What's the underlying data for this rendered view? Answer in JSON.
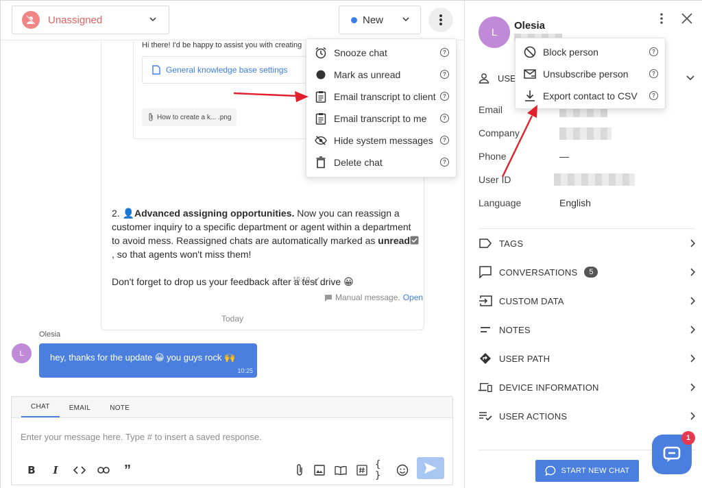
{
  "topbar": {
    "assignee_label": "Unassigned",
    "status_label": "New",
    "colors": {
      "assignee_text": "#e2605f",
      "status_dot": "#3b7de8"
    }
  },
  "chat_menu": {
    "items": [
      {
        "icon": "alarm-clock-icon",
        "label": "Snooze chat"
      },
      {
        "icon": "filled-circle-icon",
        "label": "Mark as unread"
      },
      {
        "icon": "clipboard-icon",
        "label": "Email transcript to client"
      },
      {
        "icon": "clipboard-icon",
        "label": "Email transcript to me"
      },
      {
        "icon": "eye-slash-icon",
        "label": "Hide system messages"
      },
      {
        "icon": "trash-icon",
        "label": "Delete chat"
      }
    ],
    "help_glyph": "?"
  },
  "bot_message": {
    "inner_greeting": "Hi there! I'd be happy to assist you with creating",
    "kb_link_label": "General knowledge base settings",
    "attachment_name": "How to create a k... .png",
    "point_number": "2.",
    "point_title": "Advanced assigning opportunities.",
    "point_body_1": " Now you can reassign a customer inquiry to a specific department or agent within a department to avoid mess. Reassigned chats are automatically marked as ",
    "point_bold_2": "unread",
    "point_body_2": ", so that agents won't miss them!",
    "feedback_line": "Don't forget to drop us your feedback after a test drive 😀",
    "time": "15:10",
    "manual_note": "Manual message.",
    "manual_open": "Open"
  },
  "day_separator": "Today",
  "user_message": {
    "sender": "Olesia",
    "avatar_letter": "L",
    "text": "hey, thanks for the update 😀  you guys rock 🙌",
    "time": "10:25"
  },
  "composer": {
    "tabs": [
      "CHAT",
      "EMAIL",
      "NOTE"
    ],
    "active_tab": "CHAT",
    "placeholder": "Enter your message here. Type # to insert a saved response.",
    "tool_icons": [
      "bold-icon",
      "italic-icon",
      "code-icon",
      "link-icon",
      "quote-icon",
      "paperclip-icon",
      "image-icon",
      "book-icon",
      "hashtag-icon",
      "braces-icon",
      "emoji-icon",
      "send-icon"
    ]
  },
  "contact": {
    "avatar_letter": "L",
    "name": "Olesia",
    "user_section_label": "USE",
    "fields": [
      {
        "label": "Email",
        "value": ""
      },
      {
        "label": "Company",
        "value": ""
      },
      {
        "label": "Phone",
        "value": "—"
      },
      {
        "label": "User ID",
        "value": ""
      },
      {
        "label": "Language",
        "value": "English"
      }
    ]
  },
  "contact_menu": {
    "items": [
      {
        "icon": "block-icon",
        "label": "Block person"
      },
      {
        "icon": "envelope-icon",
        "label": "Unsubscribe person"
      },
      {
        "icon": "download-icon",
        "label": "Export contact to CSV"
      }
    ],
    "help_glyph": "?"
  },
  "sections": [
    {
      "icon": "tag-icon",
      "label": "TAGS"
    },
    {
      "icon": "speech-bubble-icon",
      "label": "CONVERSATIONS",
      "badge": "5"
    },
    {
      "icon": "import-icon",
      "label": "CUSTOM DATA"
    },
    {
      "icon": "notes-icon",
      "label": "NOTES"
    },
    {
      "icon": "direction-sign-icon",
      "label": "USER PATH"
    },
    {
      "icon": "devices-icon",
      "label": "DEVICE INFORMATION"
    },
    {
      "icon": "checklist-icon",
      "label": "USER ACTIONS"
    }
  ],
  "start_chat_label": "START NEW CHAT",
  "fab_badge": "1",
  "colors": {
    "accent": "#4a7fdf",
    "avatar": "#c08ad8",
    "annotation_arrow": "#e0202a",
    "badge_red": "#e53950"
  }
}
